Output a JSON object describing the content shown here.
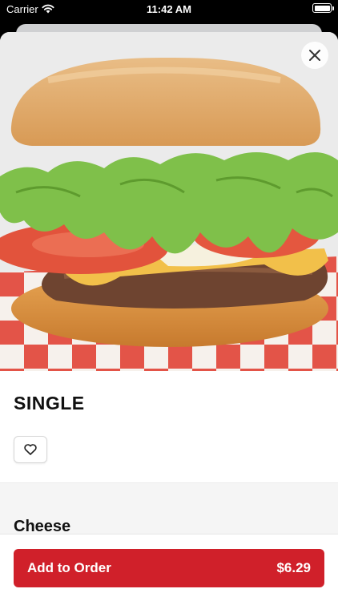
{
  "status_bar": {
    "carrier": "Carrier",
    "time": "11:42 AM"
  },
  "product": {
    "title": "SINGLE"
  },
  "section": {
    "title": "Cheese"
  },
  "order_button": {
    "label": "Add to Order",
    "price": "$6.29"
  },
  "colors": {
    "accent": "#d0202a",
    "status_bar_bg": "#000000"
  },
  "icons": {
    "close": "close-icon",
    "favorite": "heart-icon",
    "wifi": "wifi-icon",
    "battery": "battery-icon"
  }
}
